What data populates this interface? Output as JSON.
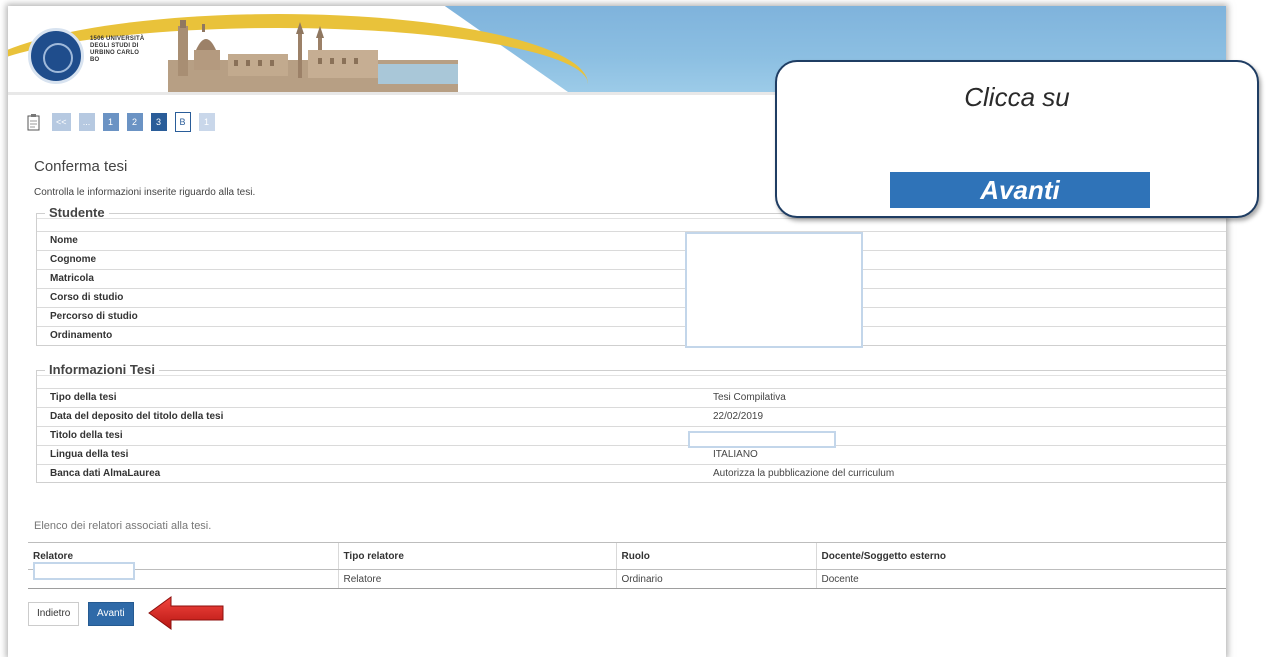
{
  "header": {
    "logo_text": "1506 UNIVERSITÀ DEGLI STUDI DI URBINO CARLO BO"
  },
  "steps": [
    "<<",
    "...",
    "1",
    "2",
    "3",
    "B",
    "1"
  ],
  "page": {
    "title": "Conferma tesi",
    "description": "Controlla le informazioni inserite riguardo alla tesi."
  },
  "studente": {
    "legend": "Studente",
    "rows": [
      "Nome",
      "Cognome",
      "Matricola",
      "Corso di studio",
      "Percorso di studio",
      "Ordinamento"
    ]
  },
  "tesi": {
    "legend": "Informazioni Tesi",
    "rows": [
      {
        "label": "Tipo della tesi",
        "value": "Tesi Compilativa"
      },
      {
        "label": "Data del deposito del titolo della tesi",
        "value": "22/02/2019"
      },
      {
        "label": "Titolo della tesi",
        "value": ""
      },
      {
        "label": "Lingua della tesi",
        "value": "ITALIANO"
      },
      {
        "label": "Banca dati AlmaLaurea",
        "value": "Autorizza la pubblicazione del curriculum"
      }
    ]
  },
  "relatori": {
    "title": "Elenco dei relatori associati alla tesi.",
    "headers": [
      "Relatore",
      "Tipo relatore",
      "Ruolo",
      "Docente/Soggetto esterno"
    ],
    "row": [
      "",
      "Relatore",
      "Ordinario",
      "Docente"
    ]
  },
  "buttons": {
    "back": "Indietro",
    "next": "Avanti"
  },
  "callout": {
    "text": "Clicca su",
    "button": "Avanti"
  },
  "colors": {
    "primary": "#2f6aa8",
    "arrow": "#e0201e",
    "callout_border": "#1f3d63"
  }
}
